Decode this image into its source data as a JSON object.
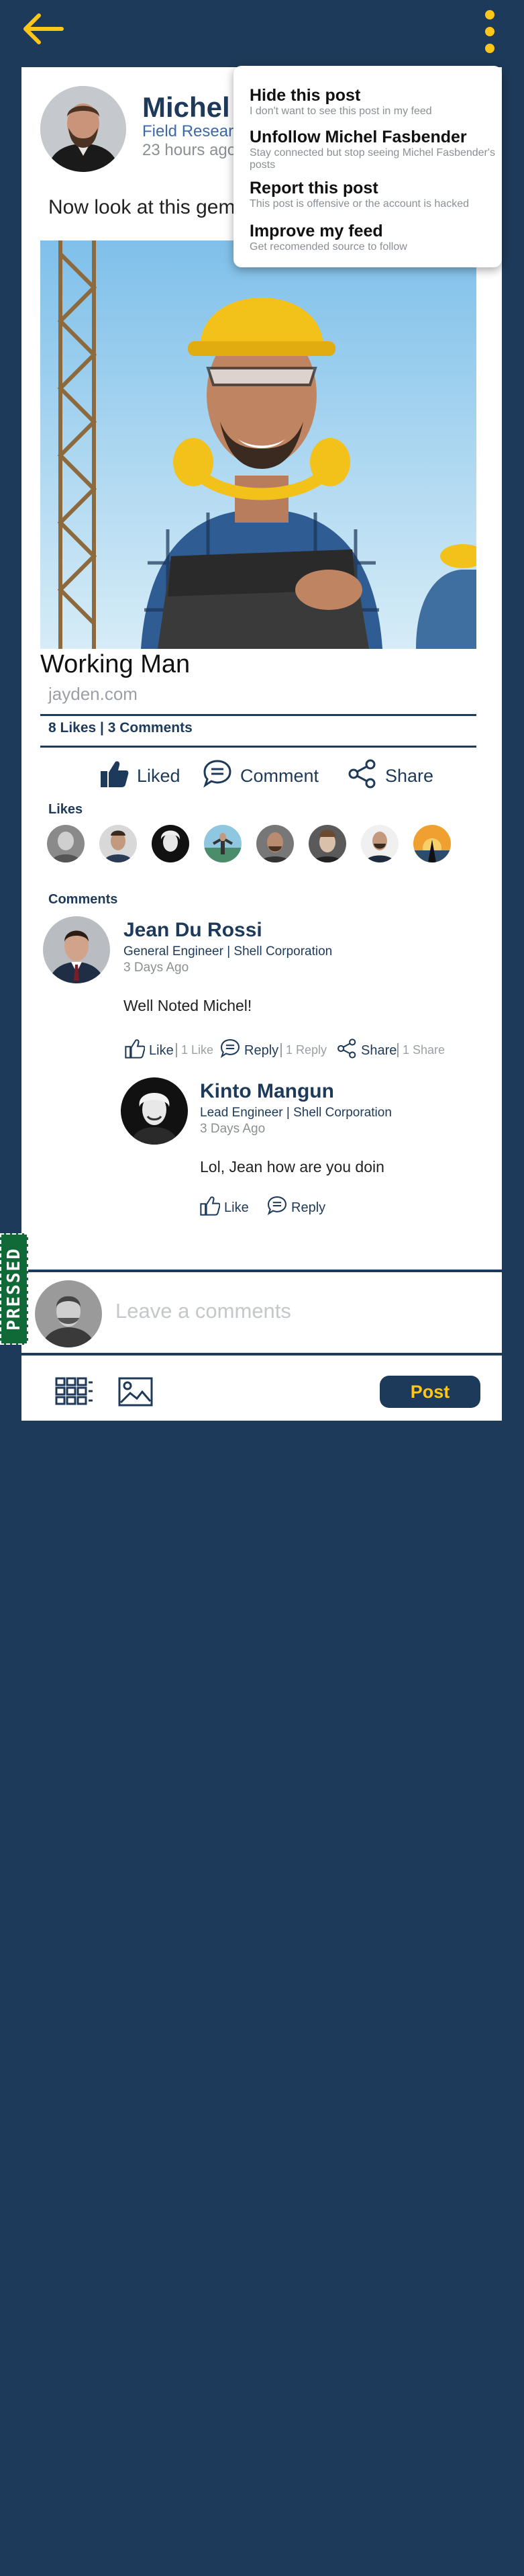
{
  "colors": {
    "navy": "#1e3a5a",
    "accent_yellow": "#ffc61a",
    "pressed_green": "#0f6a38"
  },
  "header": {
    "back_icon": "back-arrow-icon",
    "menu_icon": "more-vertical-icon"
  },
  "post": {
    "author_name": "Michel Fasbender",
    "author_role": "Field Research",
    "time": "23 hours ago",
    "text": "Now look at this gem of a photo!",
    "link_title": "Working Man",
    "link_url": "jayden.com",
    "stats": "8 Likes | 3 Comments"
  },
  "actions": {
    "liked": "Liked",
    "comment": "Comment",
    "share": "Share"
  },
  "likes_label": "Likes",
  "comments_label": "Comments",
  "comments": [
    {
      "name": "Jean Du Rossi",
      "role": "General Engineer | Shell Corporation",
      "time": "3 Days Ago",
      "text": "Well Noted Michel!",
      "like": "Like",
      "like_count": "1 Like",
      "reply": "Reply",
      "reply_count": "1 Reply",
      "share": "Share",
      "share_count": "1 Share"
    },
    {
      "name": "Kinto Mangun",
      "role": "Lead Engineer | Shell Corporation",
      "time": "3 Days Ago",
      "text": "Lol, Jean how are you doin",
      "like": "Like",
      "reply": "Reply"
    }
  ],
  "comment_box": {
    "placeholder": "Leave a comments"
  },
  "composer": {
    "grid_icon": "grid-icon",
    "image_icon": "image-icon",
    "post_label": "Post"
  },
  "pressed_label": "PRESSED",
  "menu": {
    "items": [
      {
        "title": "Hide this post",
        "desc": "I don't want to see this post in my feed"
      },
      {
        "title": "Unfollow Michel Fasbender",
        "desc": "Stay connected but stop seeing Michel Fasbender's posts"
      },
      {
        "title": "Report this post",
        "desc": "This post is offensive or the account is hacked"
      },
      {
        "title": "Improve my feed",
        "desc": "Get recomended source to follow"
      }
    ]
  }
}
